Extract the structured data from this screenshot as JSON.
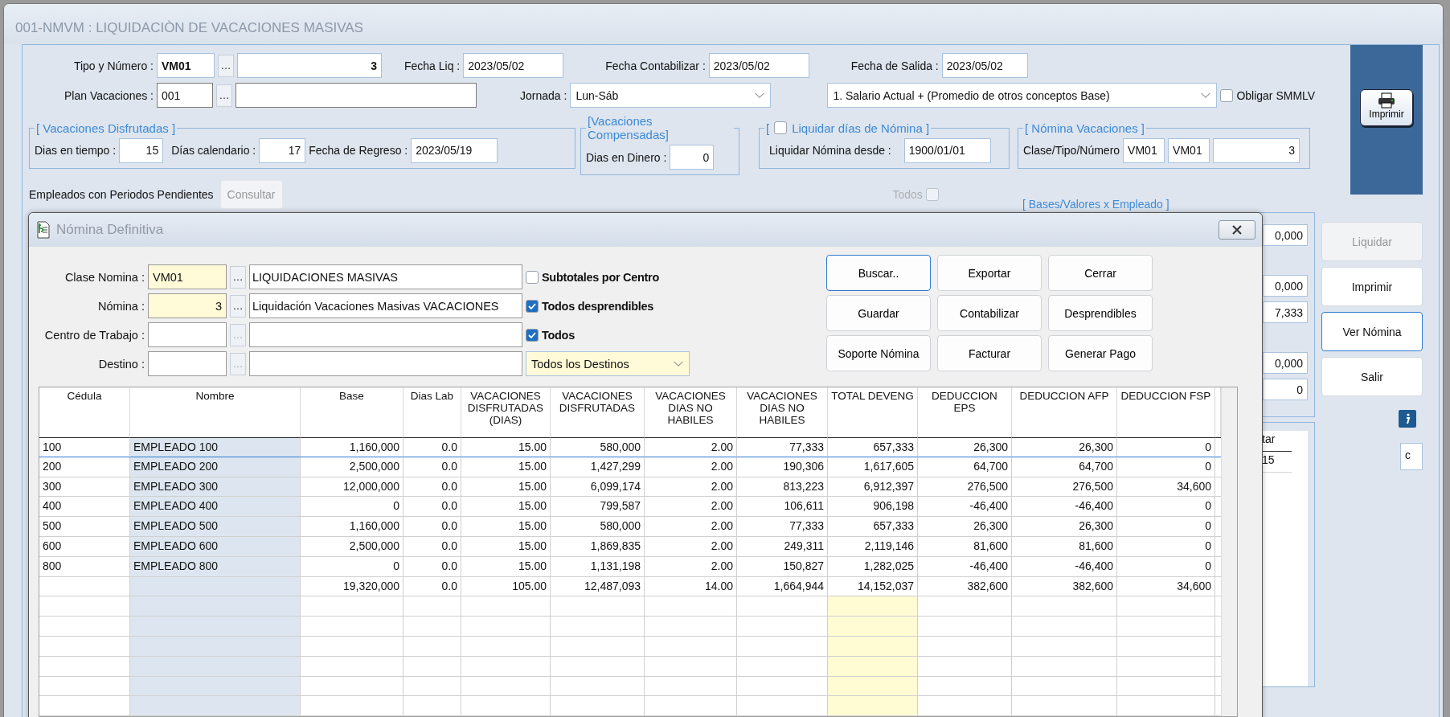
{
  "window": {
    "title": "001-NMVM : LIQUIDACIÒN DE VACACIONES MASIVAS"
  },
  "form": {
    "tipo": {
      "label": "Tipo y Número :",
      "code": "VM01",
      "browse": "…",
      "number": "3"
    },
    "fecha_liq": {
      "label": "Fecha Liq :",
      "value": "2023/05/02"
    },
    "fecha_contabilizar": {
      "label": "Fecha Contabilizar :",
      "value": "2023/05/02"
    },
    "fecha_salida": {
      "label": "Fecha de Salida :",
      "value": "2023/05/02"
    },
    "plan": {
      "label": "Plan Vacaciones :",
      "code": "001",
      "browse": "…"
    },
    "jornada": {
      "label": "Jornada :",
      "value": "Lun-Sáb"
    },
    "metodo": {
      "value": "1. Salario Actual + (Promedio de otros conceptos Base)"
    },
    "obligar_smmlv": {
      "label": "Obligar SMMLV",
      "checked": false
    },
    "disfrutadas": {
      "legend": "[ Vacaciones Disfrutadas ]",
      "dias_tiempo": {
        "label": "Dias en tiempo :",
        "value": "15"
      },
      "dias_calendario": {
        "label": "Días calendario :",
        "value": "17"
      },
      "fecha_regreso": {
        "label": "Fecha de Regreso :",
        "value": "2023/05/19"
      }
    },
    "compensadas": {
      "legend": "[Vacaciones Compensadas]",
      "dias_dinero": {
        "label": "Dias en Dinero :",
        "value": "0"
      }
    },
    "liquidar_dias": {
      "bracket": "[",
      "label": "Liquidar días de Nómina ]",
      "checked": false,
      "desde": {
        "label": "Liquidar Nómina desde :",
        "value": "1900/01/01"
      }
    },
    "nomina_vacaciones": {
      "legend": "[ Nómina Vacaciones ]",
      "label": "Clase/Tipo/Número",
      "clase": "VM01",
      "tipo": "VM01",
      "numero": "3"
    },
    "pendientes": {
      "label": "Empleados con Periodos Pendientes",
      "button": "Consultar"
    },
    "todos": {
      "label": "Todos",
      "checked": false,
      "disabled": true
    },
    "print_button": "Imprimir"
  },
  "bases": {
    "legend": "[ Bases/Valores x Empleado ]",
    "values": [
      "0,000",
      "0,000",
      "7,333",
      "0,000",
      "0"
    ]
  },
  "side_buttons": [
    {
      "label": "Liquidar",
      "disabled": true,
      "focused": false
    },
    {
      "label": "Imprimir",
      "disabled": false,
      "focused": false
    },
    {
      "label": "Ver Nómina",
      "disabled": false,
      "focused": true
    },
    {
      "label": "Salir",
      "disabled": false,
      "focused": false
    }
  ],
  "side_field": "c",
  "mini_grid": {
    "header": "tar",
    "value": "15"
  },
  "dialog": {
    "title": "Nómina Definitiva",
    "fields": [
      {
        "label": "Clase Nomina :",
        "kind": "text",
        "code": "VM01",
        "browse": "…",
        "description": "LIQUIDACIONES MASIVAS",
        "disabled": false
      },
      {
        "label": "Nómina :",
        "kind": "number",
        "code": "3",
        "browse": "…",
        "description": "Liquidación Vacaciones Masivas VACACIONES",
        "disabled": false
      },
      {
        "label": "Centro de Trabajo :",
        "kind": "text",
        "browse": "…",
        "disabled": true
      },
      {
        "label": "Destino :",
        "kind": "text",
        "browse": "…",
        "disabled": true
      }
    ],
    "options": [
      {
        "label": "Subtotales por Centro",
        "checked": false
      },
      {
        "label": "Todos desprendibles",
        "checked": true
      },
      {
        "label": "Todos",
        "checked": true
      }
    ],
    "destino_select": "Todos los Destinos",
    "buttons": [
      {
        "label": "Buscar..",
        "focused": true
      },
      {
        "label": "Exportar",
        "focused": false
      },
      {
        "label": "Cerrar",
        "focused": false
      },
      {
        "label": "Guardar",
        "focused": false
      },
      {
        "label": "Contabilizar",
        "focused": false
      },
      {
        "label": "Desprendibles",
        "focused": false
      },
      {
        "label": "Soporte Nómina",
        "focused": false
      },
      {
        "label": "Facturar",
        "focused": false
      },
      {
        "label": "Generar Pago",
        "focused": false
      }
    ],
    "table": {
      "columns": [
        {
          "label": "Cédula",
          "shaded": false,
          "highlight": false
        },
        {
          "label": "Nombre",
          "shaded": true,
          "highlight": false
        },
        {
          "label": "Base",
          "shaded": false,
          "highlight": false
        },
        {
          "label": "Dias Lab",
          "shaded": false,
          "highlight": false
        },
        {
          "label": "VACACIONES DISFRUTADAS (DIAS)",
          "shaded": false,
          "highlight": false
        },
        {
          "label": "VACACIONES DISFRUTADAS",
          "shaded": false,
          "highlight": false
        },
        {
          "label": "VACACIONES DIAS NO HABILES",
          "shaded": false,
          "highlight": false
        },
        {
          "label": "VACACIONES DIAS NO HABILES",
          "shaded": false,
          "highlight": false
        },
        {
          "label": "TOTAL DEVENG",
          "shaded": false,
          "highlight": true
        },
        {
          "label": "DEDUCCION EPS",
          "shaded": false,
          "highlight": false
        },
        {
          "label": "DEDUCCION AFP",
          "shaded": false,
          "highlight": false
        },
        {
          "label": "DEDUCCION FSP",
          "shaded": false,
          "highlight": false
        }
      ],
      "rows": [
        {
          "selected": true,
          "cells": [
            "100",
            "EMPLEADO 100",
            "1,160,000",
            "0.0",
            "15.00",
            "580,000",
            "2.00",
            "77,333",
            "657,333",
            "26,300",
            "26,300",
            "0"
          ]
        },
        {
          "selected": false,
          "cells": [
            "200",
            "EMPLEADO 200",
            "2,500,000",
            "0.0",
            "15.00",
            "1,427,299",
            "2.00",
            "190,306",
            "1,617,605",
            "64,700",
            "64,700",
            "0"
          ]
        },
        {
          "selected": false,
          "cells": [
            "300",
            "EMPLEADO 300",
            "12,000,000",
            "0.0",
            "15.00",
            "6,099,174",
            "2.00",
            "813,223",
            "6,912,397",
            "276,500",
            "276,500",
            "34,600"
          ]
        },
        {
          "selected": false,
          "cells": [
            "400",
            "EMPLEADO 400",
            "0",
            "0.0",
            "15.00",
            "799,587",
            "2.00",
            "106,611",
            "906,198",
            "-46,400",
            "-46,400",
            "0"
          ]
        },
        {
          "selected": false,
          "cells": [
            "500",
            "EMPLEADO 500",
            "1,160,000",
            "0.0",
            "15.00",
            "580,000",
            "2.00",
            "77,333",
            "657,333",
            "26,300",
            "26,300",
            "0"
          ]
        },
        {
          "selected": false,
          "cells": [
            "600",
            "EMPLEADO 600",
            "2,500,000",
            "0.0",
            "15.00",
            "1,869,835",
            "2.00",
            "249,311",
            "2,119,146",
            "81,600",
            "81,600",
            "0"
          ]
        },
        {
          "selected": false,
          "cells": [
            "800",
            "EMPLEADO 800",
            "0",
            "0.0",
            "15.00",
            "1,131,198",
            "2.00",
            "150,827",
            "1,282,025",
            "-46,400",
            "-46,400",
            "0"
          ]
        }
      ],
      "totals": [
        "19,320,000",
        "0.0",
        "105.00",
        "12,487,093",
        "14.00",
        "1,664,944",
        "14,152,037",
        "382,600",
        "382,600",
        "34,600"
      ]
    }
  }
}
